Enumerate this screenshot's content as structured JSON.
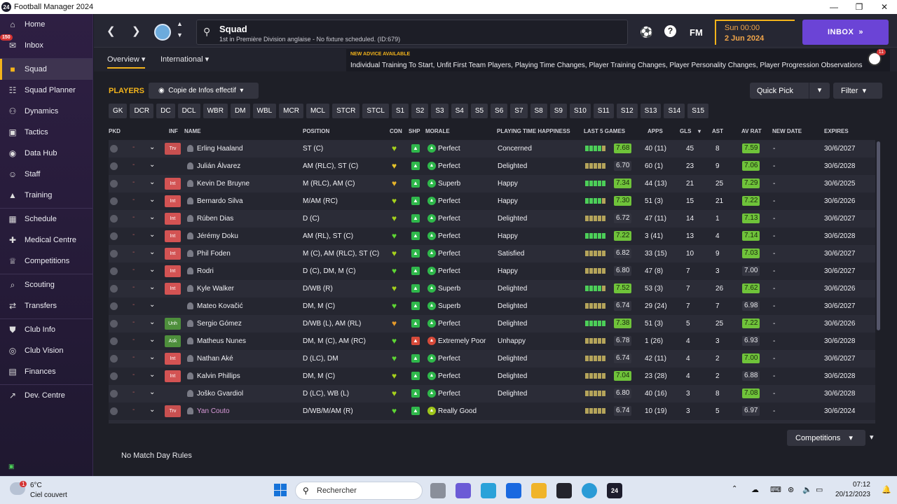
{
  "window": {
    "title": "Football Manager 2024",
    "app_badge": "24"
  },
  "nav": {
    "items": [
      {
        "label": "Home",
        "icon": "home-icon"
      },
      {
        "label": "Inbox",
        "icon": "inbox-icon",
        "badge": "150"
      },
      {
        "label": "Squad",
        "icon": "shirt-icon",
        "active": true
      },
      {
        "label": "Squad Planner",
        "icon": "planner-icon"
      },
      {
        "label": "Dynamics",
        "icon": "dynamics-icon"
      },
      {
        "label": "Tactics",
        "icon": "tactics-icon"
      },
      {
        "label": "Data Hub",
        "icon": "data-hub-icon"
      },
      {
        "label": "Staff",
        "icon": "staff-icon"
      },
      {
        "label": "Training",
        "icon": "training-icon"
      },
      {
        "label": "Schedule",
        "icon": "calendar-icon"
      },
      {
        "label": "Medical Centre",
        "icon": "medical-icon"
      },
      {
        "label": "Competitions",
        "icon": "trophy-icon"
      },
      {
        "label": "Scouting",
        "icon": "scouting-icon"
      },
      {
        "label": "Transfers",
        "icon": "transfers-icon"
      },
      {
        "label": "Club Info",
        "icon": "shield-icon"
      },
      {
        "label": "Club Vision",
        "icon": "vision-icon"
      },
      {
        "label": "Finances",
        "icon": "finances-icon"
      },
      {
        "label": "Dev. Centre",
        "icon": "dev-centre-icon"
      }
    ]
  },
  "header": {
    "title": "Squad",
    "subtitle": "1st in Première Division anglaise - No fixture scheduled. (ID:679)",
    "fm_label": "FM",
    "time": "Sun 00:00",
    "date": "2 Jun 2024",
    "inbox_label": "INBOX"
  },
  "tabs": [
    "Overview",
    "International"
  ],
  "advice": {
    "title": "NEW ADVICE AVAILABLE",
    "text": "Individual Training To Start, Unfit First Team Players, Playing Time Changes, Player Training Changes, Player Personality Changes, Player Progression Observations",
    "count": "11"
  },
  "toolbar": {
    "players_label": "PLAYERS",
    "view": "Copie de Infos effectif",
    "quick_pick": "Quick Pick",
    "filter": "Filter"
  },
  "positions": [
    "GK",
    "DCR",
    "DC",
    "DCL",
    "WBR",
    "DM",
    "WBL",
    "MCR",
    "MCL",
    "STCR",
    "STCL",
    "S1",
    "S2",
    "S3",
    "S4",
    "S5",
    "S6",
    "S7",
    "S8",
    "S9",
    "S10",
    "S11",
    "S12",
    "S13",
    "S14",
    "S15"
  ],
  "columns": {
    "pkd": "PKD",
    "inf": "INF",
    "name": "NAME",
    "position": "POSITION",
    "con": "CON",
    "shp": "SHP",
    "morale": "MORALE",
    "pth": "PLAYING TIME HAPPINESS",
    "last5": "LAST 5 GAMES",
    "apps": "APPS",
    "gls": "GLS",
    "ast": "AST",
    "avrat": "AV RAT",
    "newdate": "NEW DATE",
    "expires": "EXPIRES"
  },
  "players": [
    {
      "inf": "Trv",
      "name": "Erling Haaland",
      "position": "ST (C)",
      "morale": "Perfect",
      "pth": "Concerned",
      "form": "7.68",
      "form_hi": true,
      "apps": "40 (11)",
      "gls": "45",
      "ast": "8",
      "avrat": "7.59",
      "avrat_hi": true,
      "newdate": "-",
      "expires": "30/6/2027",
      "dash": "-",
      "bars": "gggga"
    },
    {
      "inf": "",
      "name": "Julián Álvarez",
      "position": "AM (RLC), ST (C)",
      "morale": "Perfect",
      "pth": "Delighted",
      "form": "6.70",
      "form_hi": false,
      "apps": "60 (1)",
      "gls": "23",
      "ast": "9",
      "avrat": "7.06",
      "avrat_hi": true,
      "newdate": "-",
      "expires": "30/6/2028",
      "dash": "-",
      "bars": "aaaaa"
    },
    {
      "inf": "Int",
      "name": "Kevin De Bruyne",
      "position": "M (RLC), AM (C)",
      "morale": "Superb",
      "pth": "Happy",
      "form": "7.34",
      "form_hi": true,
      "apps": "44 (13)",
      "gls": "21",
      "ast": "25",
      "avrat": "7.29",
      "avrat_hi": true,
      "newdate": "-",
      "expires": "30/6/2025",
      "dash": "-",
      "bars": "ggggg"
    },
    {
      "inf": "Int",
      "name": "Bernardo Silva",
      "position": "M/AM (RC)",
      "morale": "Perfect",
      "pth": "Happy",
      "form": "7.30",
      "form_hi": true,
      "apps": "51 (3)",
      "gls": "15",
      "ast": "21",
      "avrat": "7.22",
      "avrat_hi": true,
      "newdate": "-",
      "expires": "30/6/2026",
      "dash": "-",
      "bars": "gggga"
    },
    {
      "inf": "Int",
      "name": "Rúben Dias",
      "position": "D (C)",
      "morale": "Perfect",
      "pth": "Delighted",
      "form": "6.72",
      "form_hi": false,
      "apps": "47 (11)",
      "gls": "14",
      "ast": "1",
      "avrat": "7.13",
      "avrat_hi": true,
      "newdate": "-",
      "expires": "30/6/2027",
      "dash": "-",
      "bars": "aaaaa"
    },
    {
      "inf": "Int",
      "name": "Jérémy Doku",
      "position": "AM (RL), ST (C)",
      "morale": "Perfect",
      "pth": "Happy",
      "form": "7.22",
      "form_hi": true,
      "apps": "3 (41)",
      "gls": "13",
      "ast": "4",
      "avrat": "7.14",
      "avrat_hi": true,
      "newdate": "-",
      "expires": "30/6/2028",
      "dash": "-",
      "bars": "ggggg"
    },
    {
      "inf": "Int",
      "name": "Phil Foden",
      "position": "M (C), AM (RLC), ST (C)",
      "morale": "Perfect",
      "pth": "Satisfied",
      "form": "6.82",
      "form_hi": false,
      "apps": "33 (15)",
      "gls": "10",
      "ast": "9",
      "avrat": "7.03",
      "avrat_hi": true,
      "newdate": "-",
      "expires": "30/6/2027",
      "dash": "-",
      "bars": "aaaaa"
    },
    {
      "inf": "Int",
      "name": "Rodri",
      "position": "D (C), DM, M (C)",
      "morale": "Perfect",
      "pth": "Happy",
      "form": "6.80",
      "form_hi": false,
      "apps": "47 (8)",
      "gls": "7",
      "ast": "3",
      "avrat": "7.00",
      "avrat_hi": false,
      "newdate": "-",
      "expires": "30/6/2027",
      "dash": "-",
      "bars": "aaaaa"
    },
    {
      "inf": "Int",
      "name": "Kyle Walker",
      "position": "D/WB (R)",
      "morale": "Superb",
      "pth": "Delighted",
      "form": "7.52",
      "form_hi": true,
      "apps": "53 (3)",
      "gls": "7",
      "ast": "26",
      "avrat": "7.62",
      "avrat_hi": true,
      "newdate": "-",
      "expires": "30/6/2026",
      "dash": "-",
      "bars": "gggga"
    },
    {
      "inf": "",
      "name": "Mateo Kovačić",
      "position": "DM, M (C)",
      "morale": "Superb",
      "pth": "Delighted",
      "form": "6.74",
      "form_hi": false,
      "apps": "29 (24)",
      "gls": "7",
      "ast": "7",
      "avrat": "6.98",
      "avrat_hi": false,
      "newdate": "-",
      "expires": "30/6/2027",
      "dash": "-",
      "bars": "aaaaa"
    },
    {
      "inf": "Unh",
      "name": "Sergio Gómez",
      "position": "D/WB (L), AM (RL)",
      "morale": "Perfect",
      "pth": "Delighted",
      "form": "7.38",
      "form_hi": true,
      "apps": "51 (3)",
      "gls": "5",
      "ast": "25",
      "avrat": "7.22",
      "avrat_hi": true,
      "newdate": "-",
      "expires": "30/6/2026",
      "dash": "-",
      "bars": "ggggg"
    },
    {
      "inf": "Ask",
      "name": "Matheus Nunes",
      "position": "DM, M (C), AM (RC)",
      "morale": "Extremely Poor",
      "pth": "Unhappy",
      "form": "6.78",
      "form_hi": false,
      "apps": "1 (26)",
      "gls": "4",
      "ast": "3",
      "avrat": "6.93",
      "avrat_hi": false,
      "newdate": "-",
      "expires": "30/6/2028",
      "dash": "-",
      "bars": "aaaaa"
    },
    {
      "inf": "Int",
      "name": "Nathan Aké",
      "position": "D (LC), DM",
      "morale": "Perfect",
      "pth": "Delighted",
      "form": "6.74",
      "form_hi": false,
      "apps": "42 (11)",
      "gls": "4",
      "ast": "2",
      "avrat": "7.00",
      "avrat_hi": true,
      "newdate": "-",
      "expires": "30/6/2027",
      "dash": "-",
      "bars": "aaaaa"
    },
    {
      "inf": "Int",
      "name": "Kalvin Phillips",
      "position": "DM, M (C)",
      "morale": "Perfect",
      "pth": "Delighted",
      "form": "7.04",
      "form_hi": true,
      "apps": "23 (28)",
      "gls": "4",
      "ast": "2",
      "avrat": "6.88",
      "avrat_hi": false,
      "newdate": "-",
      "expires": "30/6/2028",
      "dash": "-",
      "bars": "aaaaa"
    },
    {
      "inf": "",
      "name": "Joško Gvardiol",
      "position": "D (LC), WB (L)",
      "morale": "Perfect",
      "pth": "Delighted",
      "form": "6.80",
      "form_hi": false,
      "apps": "40 (16)",
      "gls": "3",
      "ast": "8",
      "avrat": "7.08",
      "avrat_hi": true,
      "newdate": "-",
      "expires": "30/6/2028",
      "dash": "-",
      "bars": "aaaaa"
    },
    {
      "inf": "Trv",
      "name": "Yan Couto",
      "position": "D/WB/M/AM (R)",
      "morale": "Really Good",
      "pth": "",
      "form": "6.74",
      "form_hi": false,
      "apps": "10 (19)",
      "gls": "3",
      "ast": "5",
      "avrat": "6.97",
      "avrat_hi": false,
      "newdate": "-",
      "expires": "30/6/2024",
      "dash": "-",
      "bars": "aaaaa"
    }
  ],
  "footer": {
    "match_day_rules": "No Match Day Rules",
    "competitions": "Competitions"
  },
  "taskbar": {
    "weather_temp": "6°C",
    "weather_desc": "Ciel couvert",
    "weather_badge": "1",
    "search_placeholder": "Rechercher",
    "time": "07:12",
    "date": "20/12/2023"
  },
  "colors": {
    "accent": "#f3b41b",
    "inbox": "#6b44d6",
    "rating_high": "#6fc33a",
    "injury": "#d35353"
  }
}
